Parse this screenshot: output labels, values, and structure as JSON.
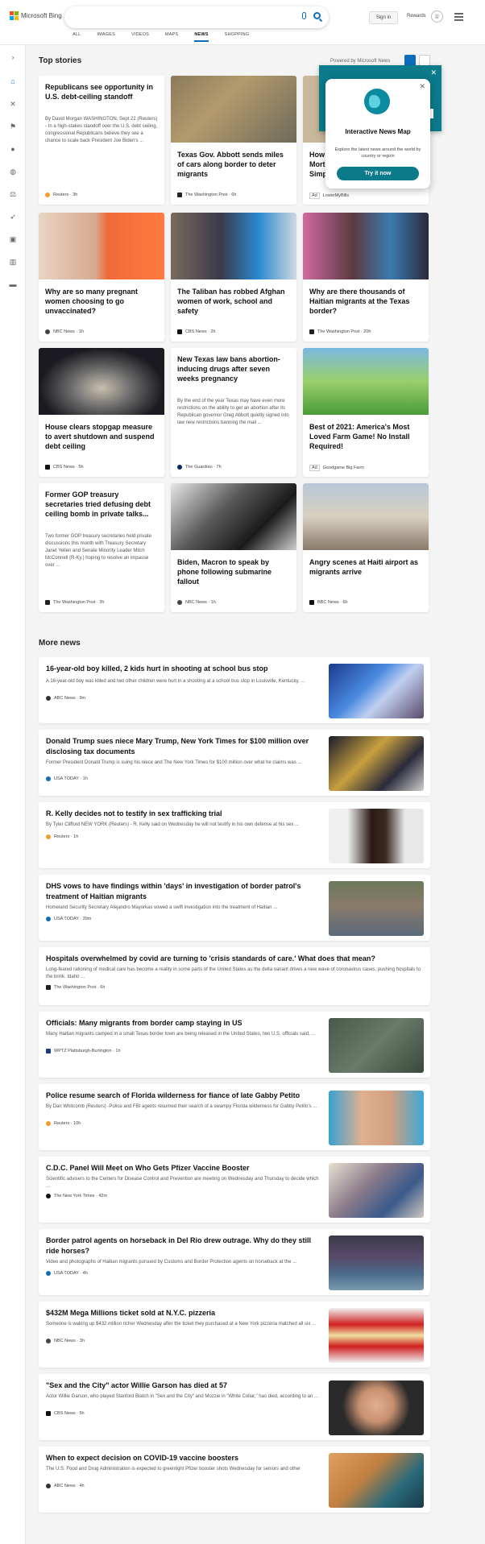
{
  "header": {
    "brand": "Microsoft Bing",
    "sign_in": "Sign in",
    "rewards": "Rewards",
    "tabs": [
      "ALL",
      "IMAGES",
      "VIDEOS",
      "MAPS",
      "NEWS",
      "SHOPPING"
    ],
    "active_tab": "NEWS"
  },
  "colors": {
    "accent": "#0f6cbd",
    "teal": "#0b7a8a"
  },
  "top_stories": {
    "title": "Top stories",
    "powered_by": "Powered by Microsoft News",
    "cards": [
      {
        "title": "Republicans see opportunity in U.S. debt-ceiling standoff",
        "snippet": "By David Morgan WASHINGTON, Sept 22 (Reuters) - In a high-stakes standoff over the U.S. debt ceiling, congressional Republicans believe they see a chance to scale back President Joe Biden's ...",
        "source": "Reuters · 3h"
      },
      {
        "title": "Texas Gov. Abbott sends miles of cars along border to deter migrants",
        "source": "The Washington Post · 6h"
      },
      {
        "title": "How Mort Simp",
        "source": "LowerMyBills",
        "ad": "Ad"
      },
      {
        "title": "Why are so many pregnant women choosing to go unvaccinated?",
        "source": "NBC News · 1h"
      },
      {
        "title": "The Taliban has robbed Afghan women of work, school and safety",
        "source": "CBS News · 2h"
      },
      {
        "title": "Why are there thousands of Haitian migrants at the Texas border?",
        "source": "The Washington Post · 20h"
      },
      {
        "title": "House clears stopgap measure to avert shutdown and suspend debt ceiling",
        "source": "CBS News · 5h"
      },
      {
        "title": "New Texas law bans abortion-inducing drugs after seven weeks pregnancy",
        "snippet": "By the end of the year Texas may have even more restrictions on the ability to get an abortion after its Republican governor Greg Abbott quietly signed into law new restrictions banning the mail ...",
        "source": "The Guardian · 7h"
      },
      {
        "title": "Best of 2021: America's Most Loved Farm Game! No Install Required!",
        "source": "Goodgame Big Farm",
        "ad": "Ad"
      },
      {
        "title": "Former GOP treasury secretaries tried defusing debt ceiling bomb in private talks...",
        "snippet": "Two former GOP treasury secretaries held private discussions this month with Treasury Secretary Janet Yellen and Senate Minority Leader Mitch McConnell (R-Ky.) hoping to resolve an impasse over ...",
        "source": "The Washington Post · 3h"
      },
      {
        "title": "Biden, Macron to speak by phone following submarine fallout",
        "source": "NBC News · 1h"
      },
      {
        "title": "Angry scenes at Haiti airport as migrants arrive",
        "source": "BBC News · 6h"
      }
    ]
  },
  "news_map_popup": {
    "title": "Interactive News Map",
    "subtitle": "Explore the latest news around the world by country or region",
    "button": "Try it now"
  },
  "more_news": {
    "title": "More news",
    "items": [
      {
        "title": "16-year-old boy killed, 2 kids hurt in shooting at school bus stop",
        "snippet": "A 16-year-old boy was killed and two other children were hurt in a shooting at a school bus stop in Louisville, Kentucky, ...",
        "source": "ABC News · 9m"
      },
      {
        "title": "Donald Trump sues niece Mary Trump, New York Times for $100 million over disclosing tax documents",
        "snippet": "Former President Donald Trump is suing his niece and The New York Times for $100 million over what he claims was ...",
        "source": "USA TODAY · 1h"
      },
      {
        "title": "R. Kelly decides not to testify in sex trafficking trial",
        "snippet": "By Tyler Clifford NEW YORK (Reuters) - R. Kelly said on Wednesday he will not testify in his own defense at his sex ...",
        "source": "Reuters · 1h"
      },
      {
        "title": "DHS vows to have findings within 'days' in investigation of border patrol's treatment of Haitian migrants",
        "snippet": "Homeland Security Secretary Alejandro Mayorkas vowed a swift investigation into the treatment of Haitian ...",
        "source": "USA TODAY · 39m"
      },
      {
        "title": "Hospitals overwhelmed by covid are turning to 'crisis standards of care.' What does that mean?",
        "snippet": "Long-feared rationing of medical care has become a reality in some parts of the United States as the delta variant drives a new wave of coronavirus cases, pushing hospitals to the brink. Idaho ...",
        "source": "The Washington Post · 6h"
      },
      {
        "title": "Officials: Many migrants from border camp staying in US",
        "snippet": "Many Haitian migrants camped in a small Texas border town are being released in the United States, two U.S. officials said, ...",
        "source": "WPTZ Plattsburgh-Burlington · 1h"
      },
      {
        "title": "Police resume search of Florida wilderness for fiance of late Gabby Petito",
        "snippet": "By Dan Whitcomb (Reuters) -Police and FBI agents resumed their search of a swampy Florida wilderness for Gabby Petito's ...",
        "source": "Reuters · 10h"
      },
      {
        "title": "C.D.C. Panel Will Meet on Who Gets Pfizer Vaccine Booster",
        "snippet": "Scientific advisers to the Centers for Disease Control and Prevention are meeting on Wednesday and Thursday to decide which ...",
        "source": "The New York Times · 42m"
      },
      {
        "title": "Border patrol agents on horseback in Del Rio drew outrage. Why do they still ride horses?",
        "snippet": "Video and photographs of Haitian migrants pursued by Customs and Border Protection agents on horseback at the ...",
        "source": "USA TODAY · 4h"
      },
      {
        "title": "$432M Mega Millions ticket sold at N.Y.C. pizzeria",
        "snippet": "Someone is waking up $432 million richer Wednesday after the ticket they purchased at a New York pizzeria matched all six ...",
        "source": "NBC News · 3h"
      },
      {
        "title": "\"Sex and the City\" actor Willie Garson has died at 57",
        "snippet": "Actor Willie Garson, who played Stanford Blatch in \"Sex and the City\" and Mozzie in \"White Collar,\" has died, according to an ...",
        "source": "CBS News · 5h"
      },
      {
        "title": "When to expect decision on COVID-19 vaccine boosters",
        "snippet": "The U.S. Food and Drug Administration is expected to greenlight Pfizer booster shots Wednesday for seniors and other",
        "source": "ABC News · 4h"
      }
    ]
  }
}
